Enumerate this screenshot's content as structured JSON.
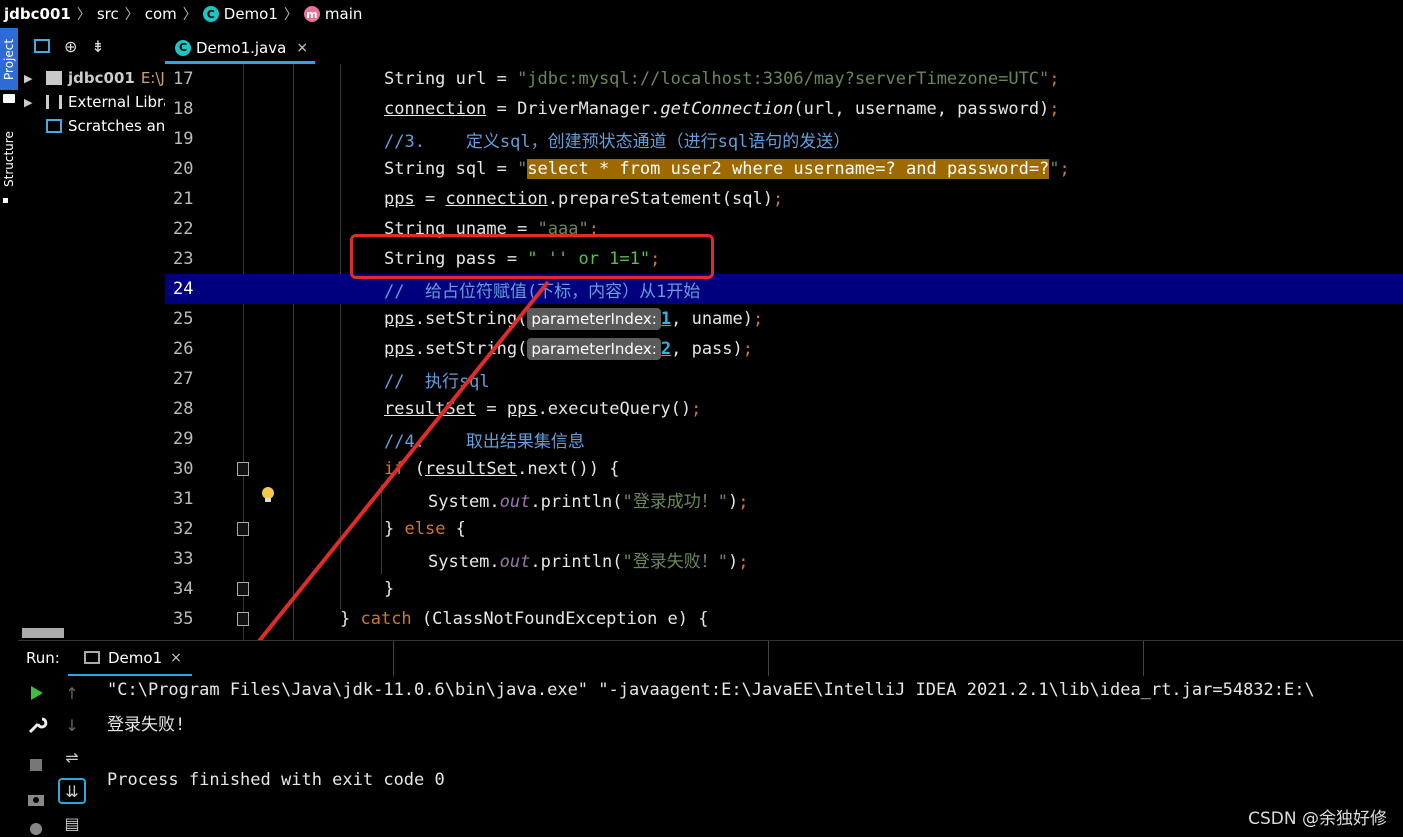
{
  "breadcrumb": {
    "project": "jdbc001",
    "src": "src",
    "pkg": "com",
    "cls": "Demo1",
    "method": "main",
    "class_icon": "C",
    "method_icon": "m"
  },
  "sidebar": {
    "project_tab": "Project",
    "structure_tab": "Structure",
    "items": [
      {
        "label": "jdbc001",
        "path": "E:\\Ja"
      },
      {
        "label": "External Libra"
      },
      {
        "label": "Scratches and"
      }
    ]
  },
  "editor": {
    "tab_label": "Demo1.java",
    "tab_close": "×",
    "lines": [
      {
        "no": "17"
      },
      {
        "no": "18"
      },
      {
        "no": "19"
      },
      {
        "no": "20"
      },
      {
        "no": "21"
      },
      {
        "no": "22"
      },
      {
        "no": "23"
      },
      {
        "no": "24"
      },
      {
        "no": "25"
      },
      {
        "no": "26"
      },
      {
        "no": "27"
      },
      {
        "no": "28"
      },
      {
        "no": "29"
      },
      {
        "no": "30"
      },
      {
        "no": "31"
      },
      {
        "no": "32"
      },
      {
        "no": "33"
      },
      {
        "no": "34"
      },
      {
        "no": "35"
      }
    ],
    "code": {
      "l17_a": "String url = ",
      "l17_str": "\"jdbc:mysql://localhost:3306/may?serverTimezone=UTC\"",
      "l17_semi": ";",
      "l18_conn": "connection",
      "l18_b": " = DriverManager.",
      "l18_m": "getConnection",
      "l18_c": "(url, username, password)",
      "l18_semi": ";",
      "l19": "//3.    定义sql，创建预状态通道（进行sql语句的发送）",
      "l20_a": "String sql = ",
      "l20_q1": "\"",
      "l20_hl": "select * from user2 where username=? and password=?",
      "l20_q2": "\"",
      "l20_semi": ";",
      "l21_pps": "pps",
      "l21_b": " = ",
      "l21_conn": "connection",
      "l21_c": ".prepareStatement(sql)",
      "l21_semi": ";",
      "l22_a": "String uname = ",
      "l22_str": "\"aaa\"",
      "l22_semi": ";",
      "l23_a": "String pass = ",
      "l23_str": "\" '' or 1=1\"",
      "l23_semi": ";",
      "l24": "//  给占位符赋值(下标，内容）从1开始",
      "l25_pps": "pps",
      "l25_b": ".setString(",
      "l25_hint": "parameterIndex:",
      "l25_num": "1",
      "l25_c": ", uname)",
      "l25_semi": ";",
      "l26_pps": "pps",
      "l26_b": ".setString(",
      "l26_hint": "parameterIndex:",
      "l26_num": "2",
      "l26_c": ", pass)",
      "l26_semi": ";",
      "l27": "//  执行sql",
      "l28_rs": "resultSet",
      "l28_b": " = ",
      "l28_pps": "pps",
      "l28_c": ".executeQuery()",
      "l28_semi": ";",
      "l29": "//4.    取出结果集信息",
      "l30_if": "if",
      "l30_b": " (",
      "l30_rs": "resultSet",
      "l30_c": ".next()) {",
      "l31_a": "System.",
      "l31_out": "out",
      "l31_b": ".println(",
      "l31_str": "\"登录成功！\"",
      "l31_c": ")",
      "l31_semi": ";",
      "l32_a": "} ",
      "l32_else": "else",
      "l32_b": " {",
      "l33_a": "System.",
      "l33_out": "out",
      "l33_b": ".println(",
      "l33_str": "\"登录失败！\"",
      "l33_c": ")",
      "l33_semi": ";",
      "l34": "}",
      "l35_a": "} ",
      "l35_catch": "catch",
      "l35_b": " (ClassNotFoundException e) {"
    }
  },
  "run": {
    "label": "Run:",
    "tab_label": "Demo1",
    "tab_close": "×",
    "console": [
      "\"C:\\Program Files\\Java\\jdk-11.0.6\\bin\\java.exe\" \"-javaagent:E:\\JavaEE\\IntelliJ IDEA 2021.2.1\\lib\\idea_rt.jar=54832:E:\\",
      "登录失败!",
      "",
      "Process finished with exit code 0"
    ]
  },
  "watermark": "CSDN @余独好修",
  "colors": {
    "keyword": "#cc7832",
    "string": "#6a8759",
    "comment": "#629ed8",
    "current_line": "#00007e",
    "highlight": "#9e6a00",
    "annotation": "#e02b2b",
    "tab_underline": "#2ca7e0"
  }
}
